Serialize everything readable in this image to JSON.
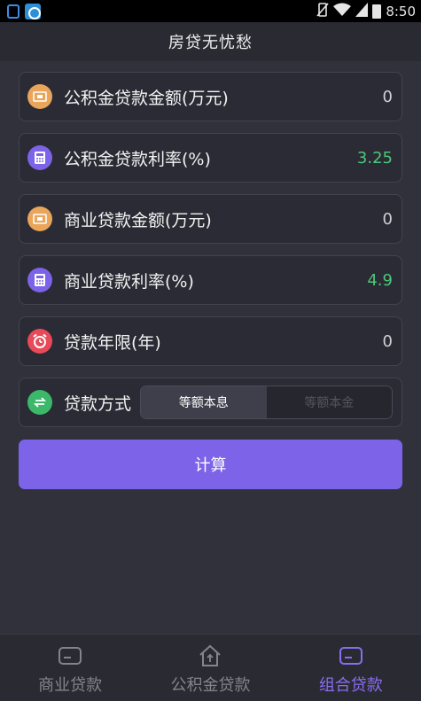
{
  "status_bar": {
    "time": "8:50",
    "icons": [
      "lock-icon",
      "app-icon",
      "vibrate-icon",
      "wifi-icon",
      "signal-icon",
      "battery-icon"
    ]
  },
  "header": {
    "title": "房贷无忧愁"
  },
  "form": {
    "fund_amount": {
      "label": "公积金贷款金额(万元)",
      "value": "0",
      "icon": "money-icon"
    },
    "fund_rate": {
      "label": "公积金贷款利率(%)",
      "value": "3.25",
      "icon": "calculator-icon"
    },
    "commercial_amount": {
      "label": "商业贷款金额(万元)",
      "value": "0",
      "icon": "money-icon"
    },
    "commercial_rate": {
      "label": "商业贷款利率(%)",
      "value": "4.9",
      "icon": "calculator-icon"
    },
    "years": {
      "label": "贷款年限(年)",
      "value": "0",
      "icon": "alarm-clock-icon"
    },
    "method": {
      "label": "贷款方式",
      "icon": "exchange-icon",
      "options": [
        "等额本息",
        "等额本金"
      ],
      "selected": "等额本息"
    }
  },
  "calculate_label": "计算",
  "tabs": [
    {
      "label": "商业贷款",
      "icon": "card-icon",
      "active": false
    },
    {
      "label": "公积金贷款",
      "icon": "house-icon",
      "active": false
    },
    {
      "label": "组合贷款",
      "icon": "card-icon",
      "active": true
    }
  ],
  "colors": {
    "background": "#31313b",
    "accent": "#7c63e8",
    "green_value": "#4cc777",
    "orange_icon": "#e9a55a",
    "red_icon": "#e84a59",
    "green_icon": "#3bb86a"
  }
}
